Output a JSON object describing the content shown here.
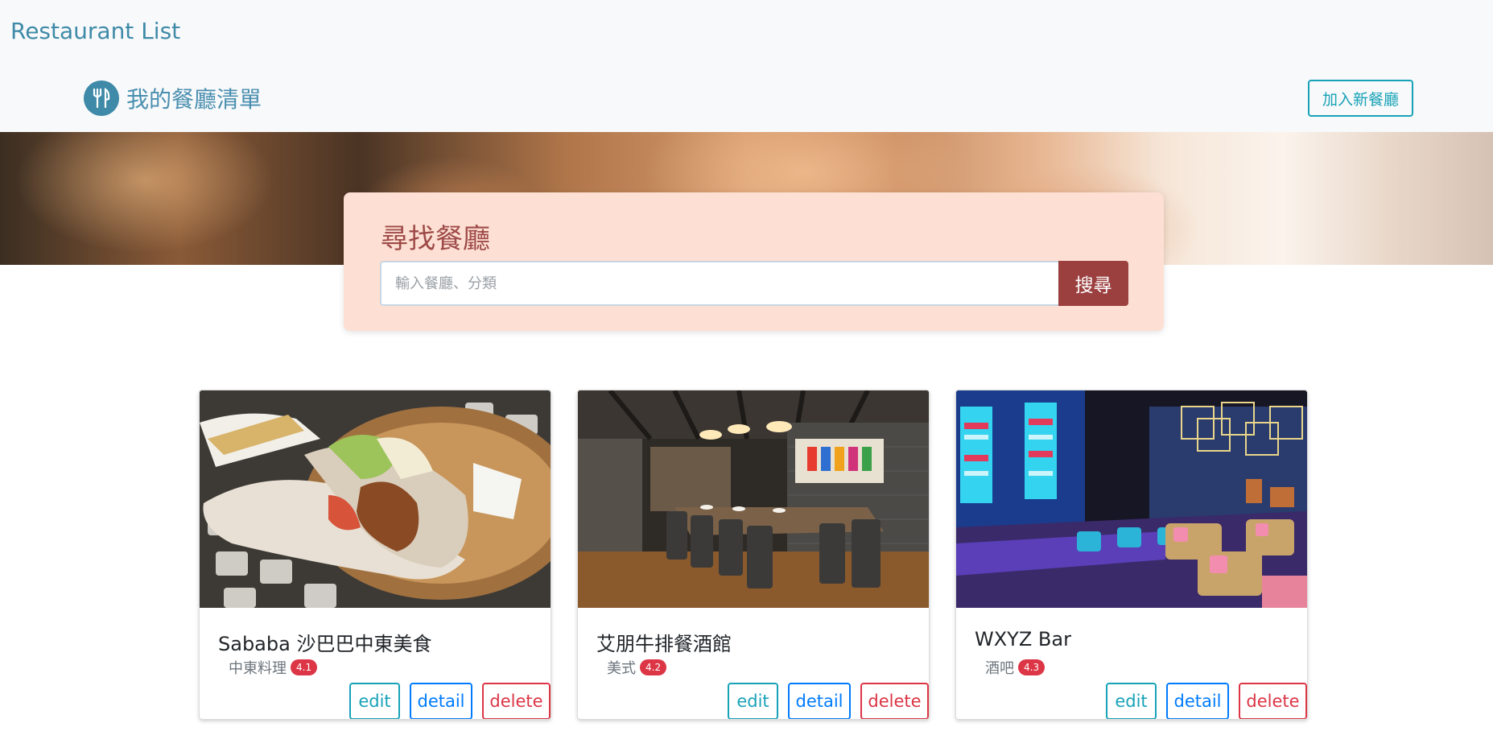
{
  "navbar": {
    "brand": "Restaurant List",
    "logo_icon": "utensils-icon",
    "title": "我的餐廳清單",
    "add_button": "加入新餐廳"
  },
  "search": {
    "title": "尋找餐廳",
    "placeholder": "輸入餐廳、分類",
    "button": "搜尋"
  },
  "restaurants": [
    {
      "name": "Sababa 沙巴巴中東美食",
      "category": "中東料理",
      "rating": "4.1",
      "image": "pita-wrap-food-photo"
    },
    {
      "name": "艾朋牛排餐酒館",
      "category": "美式",
      "rating": "4.2",
      "image": "dining-room-photo"
    },
    {
      "name": "WXYZ Bar",
      "category": "酒吧",
      "rating": "4.3",
      "image": "neon-bar-lounge-photo"
    }
  ],
  "actions": {
    "edit": "edit",
    "detail": "detail",
    "delete": "delete"
  },
  "colors": {
    "brand": "#3e8aa8",
    "info": "#17a2b8",
    "primary": "#007bff",
    "danger": "#dc3545",
    "search_bg": "#fde0d3",
    "search_btn": "#9b3f3f"
  }
}
